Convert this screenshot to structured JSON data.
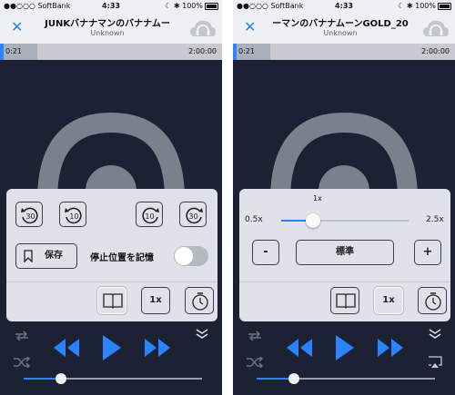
{
  "status_bar": {
    "carrier": "●●○○○ SoftBank",
    "time": "4:33",
    "right_icons": "☾ ✱",
    "battery": "100%"
  },
  "left_screen": {
    "title": "JUNKバナナマンのバナナムー",
    "subtitle": "Unknown",
    "position": "0:21",
    "duration": "2:00:00",
    "playback_fraction": 0.17,
    "skip_back_30": "30",
    "skip_back_10": "10",
    "skip_fwd_10": "10",
    "skip_fwd_30": "30",
    "save_label": "保存",
    "remember_label": "停止位置を記憶",
    "remember_enabled": false,
    "speed_button": "1x",
    "volume_fraction": 0.21
  },
  "right_screen": {
    "title": "ーマンのバナナムーンGOLD_20",
    "subtitle": "Unknown",
    "position": "0:21",
    "duration": "2:00:00",
    "playback_fraction": 0.17,
    "speed_current": "1x",
    "speed_min": "0.5x",
    "speed_max": "2.5x",
    "speed_value": 1.0,
    "minus_label": "-",
    "standard_label": "標準",
    "plus_label": "+",
    "speed_button": "1x",
    "volume_fraction": 0.21
  },
  "colors": {
    "accent": "#2a84ff",
    "background": "#1c2233",
    "panel": "#dfe2e8"
  },
  "icons": [
    "close-icon",
    "headphones-cloud-icon",
    "skip-back-30-icon",
    "skip-back-10-icon",
    "skip-forward-10-icon",
    "skip-forward-30-icon",
    "bookmark-icon",
    "book-icon",
    "timer-icon",
    "repeat-icon",
    "shuffle-icon",
    "rewind-icon",
    "play-icon",
    "fast-forward-icon",
    "collapse-chevron-icon",
    "airplay-icon"
  ]
}
